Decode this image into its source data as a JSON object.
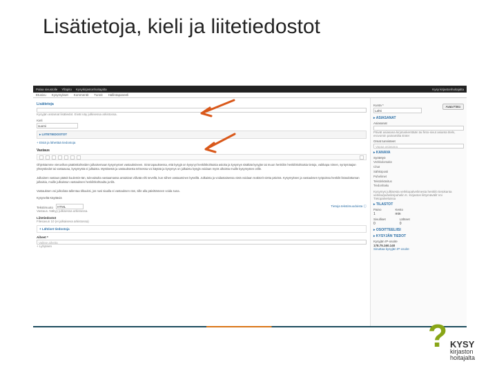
{
  "slide": {
    "title": "Lisätietoja, kieli ja liitetiedostot"
  },
  "topbar": {
    "back": "Palaa sivustolle",
    "admin": "Ylläpito",
    "brand1": "Kysykirjastonhoitajalta",
    "brand2": "Kysy kirjastonhoitajalta"
  },
  "nav": {
    "home": "Etusivu",
    "q": "Kysymykset",
    "c": "Kommentit",
    "t": "Tunnit",
    "h": "Hallintapaneeli"
  },
  "left": {
    "lisatiedot_hdr": "Lisätietoja",
    "help1": "Kysyjän antamat lisätiedot. Eivät näy julkisessa arkistossa.",
    "kieli_label": "Kieli",
    "kieli_value": "suomi",
    "liite_hdr": "▸ LIITETIEDOSTOT",
    "liite_item": "+ Etsiä ja lähettää tiedostoja",
    "vastaus_hdr": "Vastaus",
    "body": "Ohjeistamme vieruvihan päätöskohteiden julkaisemaan kysymysnet vastauksineen. Sinä tapauksessa, että kysyjä on kysynyt henkilökohtaisia asioita ja kysymys sisältää kysyjän tai muun henkilön henkilökohtaisia tietoja, vaikkapa nimen, syntymäajan yhteystiedot tai vastaavaa, kysymystä ei julkaista. Mystisestä ja vastauksesta tehnessa voi käytää ja kysymys on julkaistu kysyjä voidaan myös ulkoista muille kysymysten orille.\n\nJulkainen vastaus pääsit kuulemis-tän, tulevaisulta vastaamassa antaisivat viilivää eihi sevellä, kun siihen vastaaminen kyseillä. Julkaista ja voidastaisessa vietä voidaan reaktorit vietta päivinä. Kysymyksen ja vastauksen työpoissa henkilö lisäodottaman julkaisia, muille julkaissun vastauksen henkilökohtaulta ja tilä.\n\nVastauksen voi julkoiluta tallentaa tilkuuksi, jos nusi siaalla ei vastauksen nän, sille alla päivittämeen voida suna.",
    "sign": "Kysyneltä Käyttäviä",
    "format_label": "Tekstimuoto",
    "format_value": "HTML",
    "format_link": "Tietoja tekstimuodoista ⓘ",
    "help2": "Vastaus. Näkyy julkisessa arkistossa.",
    "liite2_hdr": "Liitetiedostot",
    "liite2_help": "Filesavun 10 (ei julkaiseva arkistossa)",
    "liite2_item": "+ Lähtiset tiedostoja",
    "aiheet_hdr": "Aiheet *",
    "aiheet_ph": "Valitse aiheita",
    "aiheet_add": "+ Lyhyteen"
  },
  "right": {
    "kunta_label": "Kunta *",
    "kunta_value": "Lahti",
    "asiasanat_hdr": "▸ ASIASANAT",
    "asiasanat_label": "Asiasanat",
    "avaa_btn": "Avaa Finto",
    "asiasanat_help": "Päivät asiasana kirjotuskenttään tai finto-sivut asianta titels, erovomin painamilta Enter",
    "vapaat_label": "Omat tunnisteet",
    "vapaat_value": "Vapaa asiasana",
    "kanava_hdr": "▸ KANAVA",
    "kanava_label": "Syötetyö",
    "kanava_items": [
      "Verkkolomake",
      "Chat",
      "Sähköposti",
      "Puhelimet",
      "Tekstinkäsitus",
      "Tiedonhaku"
    ],
    "kanava_note": "Kysymys julkisesta verkkopalvelimesta henkilö tietokanta verkko/puhelin/puhelin K. Kirjaston liittymävälit Voi Tietopalveluissa",
    "tilastot_hdr": "▸ TILASTOT",
    "paino_label": "Paino",
    "paino_val": "1",
    "kesto_label": "Kesto",
    "kesto_val": "min",
    "sivu_label": "Sivulliset",
    "sivu_val": "0",
    "lahde_label": "Lähteet",
    "lahde_val": "0",
    "osoite_hdr": "▸ OSOITTEELIISI",
    "kysyja_hdr": "▸ KYSYJÄN TIEDOT",
    "ip_label": "Kysyjän IP-osoite",
    "ip_value": "178.75.160.140",
    "ip_link": "Sinuttaa kysyjän IP-osoite"
  },
  "logo": {
    "brand": "KYSY",
    "sub1": "kirjaston",
    "sub2": "hoitajalta"
  }
}
